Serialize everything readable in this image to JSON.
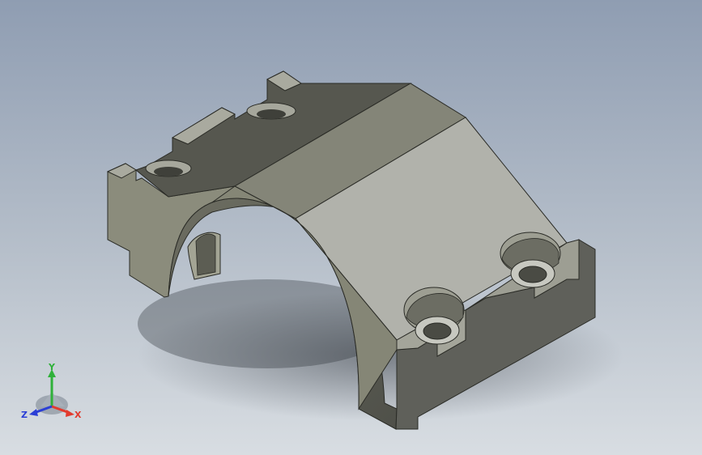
{
  "viewport": {
    "background_top": "#8f9db2",
    "background_bottom": "#d8dde2"
  },
  "model": {
    "part": "clamp-block",
    "face_colors": {
      "top_dark": "#56574f",
      "top_mid": "#858679",
      "top_light": "#b0b1aa",
      "side_front": "#8a8b7c",
      "side_right": "#5f605a",
      "hole_shadow": "#4a4b44"
    }
  },
  "triad": {
    "x_label": "X",
    "y_label": "Y",
    "z_label": "Z",
    "x_color": "#e23b2e",
    "y_color": "#2fb13a",
    "z_color": "#2b3fd6"
  }
}
